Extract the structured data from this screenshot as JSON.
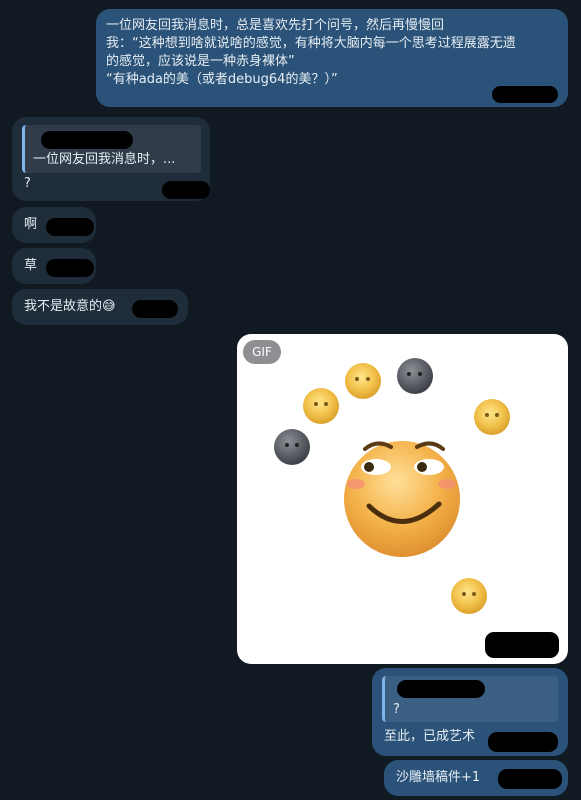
{
  "messages": [
    {
      "text": "一位网友回我消息时，总是喜欢先打个问号，然后再慢慢回\n我：“这种想到啥就说啥的感觉，有种将大脑内每一个思考过程展露无遗\n的感觉，应该说是一种赤身裸体”\n“有种ada的美（或者debug64的美？）”"
    },
    {
      "quote_text": "一位网友回我消息时，...",
      "text": "?"
    },
    {
      "text": "啊"
    },
    {
      "text": "草"
    },
    {
      "text": "我不是故意的😅"
    },
    {
      "gif_badge": "GIF"
    },
    {
      "quote_text": "?",
      "text": "至此，已成艺术"
    },
    {
      "text": "沙雕墙稿件+1"
    }
  ]
}
